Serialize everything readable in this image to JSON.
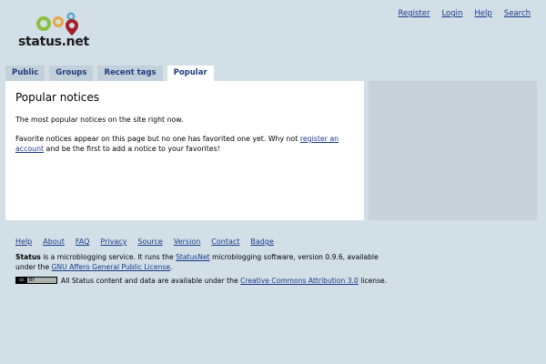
{
  "brand": {
    "name": "status.net"
  },
  "topnav": {
    "register": "Register",
    "login": "Login",
    "help": "Help",
    "search": "Search"
  },
  "tabs": [
    {
      "label": "Public",
      "active": false
    },
    {
      "label": "Groups",
      "active": false
    },
    {
      "label": "Recent tags",
      "active": false
    },
    {
      "label": "Popular",
      "active": true
    }
  ],
  "content": {
    "title": "Popular notices",
    "intro": "The most popular notices on the site right now.",
    "empty_before": "Favorite notices appear on this page but no one has favorited one yet. Why not ",
    "empty_link": "register an account",
    "empty_after": " and be the first to add a notice to your favorites!"
  },
  "footer": {
    "links": [
      "Help",
      "About",
      "FAQ",
      "Privacy",
      "Source",
      "Version",
      "Contact",
      "Badge"
    ],
    "site_name": "Status",
    "about_1": " is a microblogging service. It runs the ",
    "statusnet_link": "StatusNet",
    "about_2": " microblogging software, version 0.9.6, available under the ",
    "agpl_link": "GNU Affero General Public License",
    "about_3": ".",
    "badge_cc": "cc",
    "badge_by": "BY",
    "license_1": "All Status content and data are available under the ",
    "cc_link": "Creative Commons Attribution 3.0",
    "license_2": " license."
  }
}
